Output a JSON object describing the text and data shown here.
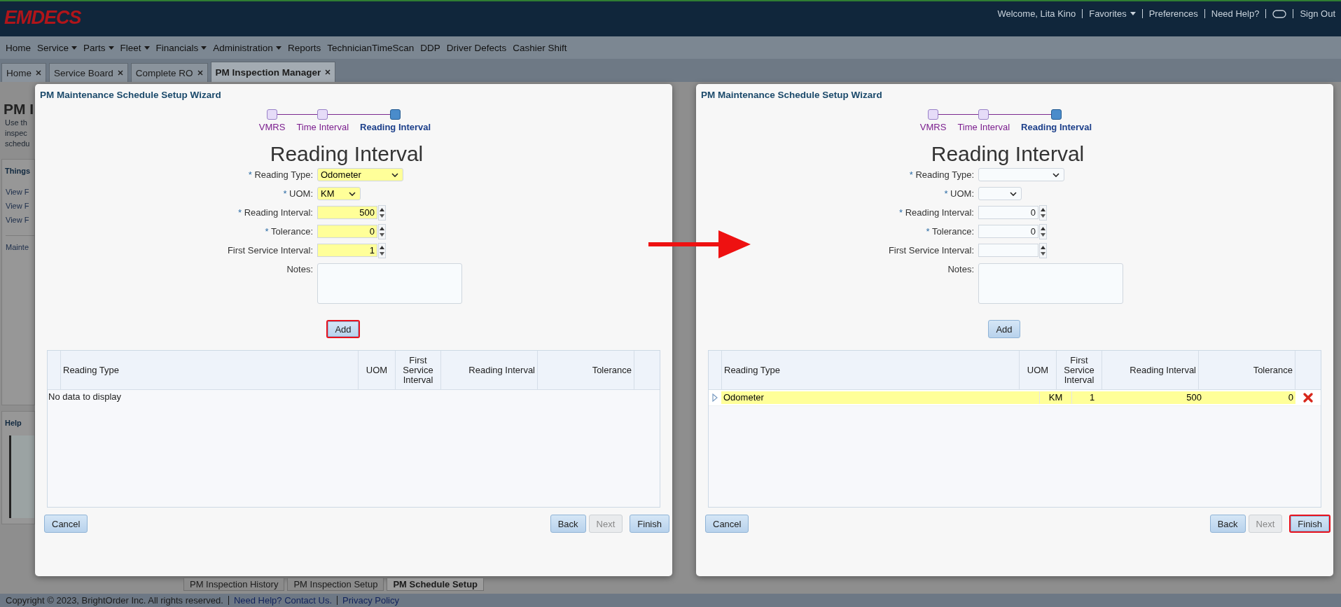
{
  "header": {
    "logo": "EMDECS",
    "welcome": "Welcome, Lita Kino",
    "links": [
      {
        "kind": "link",
        "label": "Favorites",
        "dropdown": true
      },
      {
        "kind": "link",
        "label": "Preferences",
        "dropdown": false
      },
      {
        "kind": "link",
        "label": "Need Help?",
        "dropdown": false
      },
      {
        "kind": "toggle"
      },
      {
        "kind": "link",
        "label": "Sign Out",
        "dropdown": false
      }
    ]
  },
  "menu": [
    {
      "label": "Home",
      "dropdown": false
    },
    {
      "label": "Service",
      "dropdown": true
    },
    {
      "label": "Parts",
      "dropdown": true
    },
    {
      "label": "Fleet",
      "dropdown": true
    },
    {
      "label": "Financials",
      "dropdown": true
    },
    {
      "label": "Administration",
      "dropdown": true
    },
    {
      "label": "Reports",
      "dropdown": false
    },
    {
      "label": "TechnicianTimeScan",
      "dropdown": false
    },
    {
      "label": "DDP",
      "dropdown": false
    },
    {
      "label": "Driver Defects",
      "dropdown": false
    },
    {
      "label": "Cashier Shift",
      "dropdown": false
    }
  ],
  "tabs": [
    {
      "label": "Home",
      "selected": false
    },
    {
      "label": "Service Board",
      "selected": false
    },
    {
      "label": "Complete RO",
      "selected": false
    },
    {
      "label": "PM Inspection Manager",
      "selected": true
    }
  ],
  "background_page": {
    "title": "PM I",
    "intro_lines": [
      "Use th",
      "inspec",
      "schedu"
    ],
    "panel_title": "Things",
    "links": [
      "View F",
      "View F",
      "View F"
    ],
    "section_link": "Mainte",
    "help_title": "Help",
    "bottom_tabs": [
      {
        "label": "PM Inspection History",
        "selected": false
      },
      {
        "label": "PM Inspection Setup",
        "selected": false
      },
      {
        "label": "PM Schedule Setup",
        "selected": true
      }
    ]
  },
  "dialogs": [
    {
      "title": "PM Maintenance Schedule Setup Wizard",
      "steps": [
        {
          "label": "VMRS",
          "selected": false
        },
        {
          "label": "Time Interval",
          "selected": false
        },
        {
          "label": "Reading Interval",
          "selected": true
        }
      ],
      "heading": "Reading Interval",
      "fields": [
        {
          "label": "Reading Type:",
          "required_mark": "*",
          "kind": "select",
          "value": "Odometer",
          "highlighted": true
        },
        {
          "label": "UOM:",
          "required_mark": "*",
          "kind": "select",
          "value": "KM",
          "highlighted": true
        },
        {
          "label": "Reading Interval:",
          "required_mark": "*",
          "kind": "number",
          "value": "500",
          "highlighted": true
        },
        {
          "label": "Tolerance:",
          "required_mark": "*",
          "kind": "number",
          "value": "0",
          "highlighted": true
        },
        {
          "label": "First Service Interval:",
          "kind": "number",
          "value": "1",
          "highlighted": true
        },
        {
          "label": "Notes:",
          "kind": "textarea",
          "highlighted": false
        }
      ],
      "add_button": {
        "label": "Add",
        "highlighted": true
      },
      "table": {
        "columns": [
          "Reading Type",
          "UOM",
          "First Service Interval",
          "Reading Interval",
          "Tolerance"
        ],
        "empty_text": "No data to display"
      },
      "buttons": [
        {
          "label": "Cancel",
          "disabled": false,
          "highlighted": false
        },
        {
          "label": "Back",
          "disabled": false,
          "highlighted": false
        },
        {
          "label": "Next",
          "disabled": true,
          "highlighted": false
        },
        {
          "label": "Finish",
          "disabled": false,
          "highlighted": false
        }
      ]
    },
    {
      "title": "PM Maintenance Schedule Setup Wizard",
      "steps": [
        {
          "label": "VMRS",
          "selected": false
        },
        {
          "label": "Time Interval",
          "selected": false
        },
        {
          "label": "Reading Interval",
          "selected": true
        }
      ],
      "heading": "Reading Interval",
      "fields": [
        {
          "label": "Reading Type:",
          "required_mark": "*",
          "kind": "select",
          "highlighted": false
        },
        {
          "label": "UOM:",
          "required_mark": "*",
          "kind": "select",
          "highlighted": false
        },
        {
          "label": "Reading Interval:",
          "required_mark": "*",
          "kind": "number",
          "value": "0",
          "highlighted": false
        },
        {
          "label": "Tolerance:",
          "required_mark": "*",
          "kind": "number",
          "value": "0",
          "highlighted": false
        },
        {
          "label": "First Service Interval:",
          "kind": "number",
          "highlighted": false
        },
        {
          "label": "Notes:",
          "kind": "textarea",
          "highlighted": false
        }
      ],
      "add_button": {
        "label": "Add",
        "highlighted": false
      },
      "table": {
        "columns": [
          "Reading Type",
          "UOM",
          "First Service Interval",
          "Reading Interval",
          "Tolerance"
        ],
        "rows": [
          {
            "cells": [
              "Odometer",
              "KM",
              "1",
              "500",
              "0"
            ],
            "highlighted": true
          }
        ]
      },
      "buttons": [
        {
          "label": "Cancel",
          "disabled": false,
          "highlighted": false
        },
        {
          "label": "Back",
          "disabled": false,
          "highlighted": false
        },
        {
          "label": "Next",
          "disabled": true,
          "highlighted": false
        },
        {
          "label": "Finish",
          "disabled": false,
          "highlighted": true
        }
      ]
    }
  ],
  "footer": {
    "copyright": "Copyright © 2023, BrightOrder Inc. All rights reserved.",
    "links": [
      "Need Help? Contact Us.",
      "Privacy Policy"
    ]
  }
}
